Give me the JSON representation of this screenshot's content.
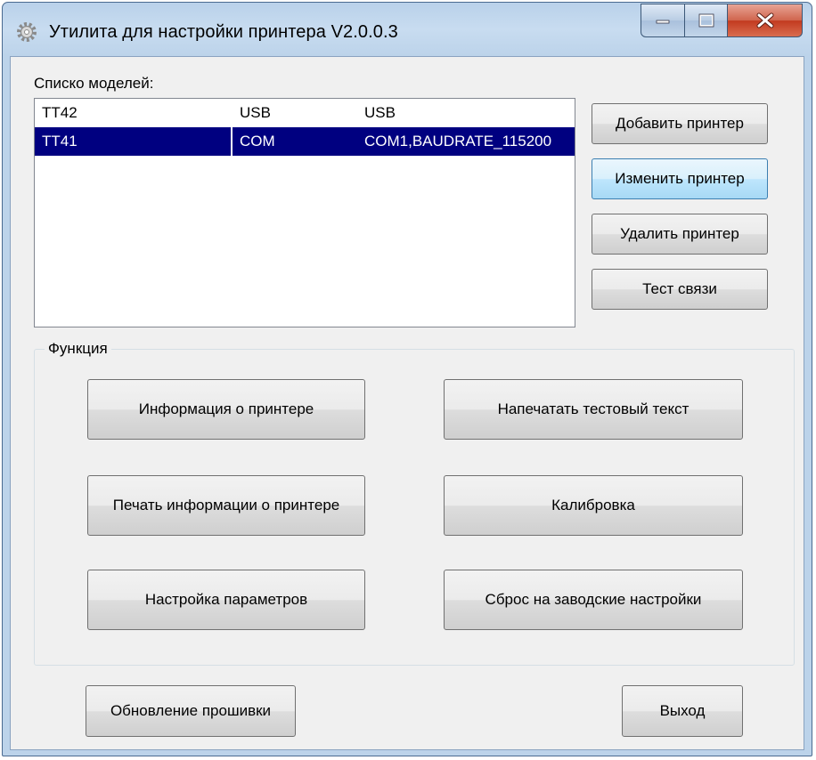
{
  "window": {
    "title": "Утилита для настройки принтера  V2.0.0.3"
  },
  "models": {
    "label": "Списко моделей:",
    "rows": [
      {
        "model": "TT42",
        "port": "USB",
        "settings": "USB",
        "selected": false
      },
      {
        "model": "TT41",
        "port": "COM",
        "settings": "COM1,BAUDRATE_115200",
        "selected": true
      }
    ]
  },
  "side_buttons": {
    "add": "Добавить принтер",
    "edit": "Изменить принтер",
    "delete": "Удалить принтер",
    "test": "Тест связи"
  },
  "function_group": {
    "label": "Функция",
    "buttons": {
      "printer_info": "Информация о принтере",
      "print_test_text": "Напечатать тестовый текст",
      "print_printer_info": "Печать информации о принтере",
      "calibration": "Калибровка",
      "param_settings": "Настройка параметров",
      "factory_reset": "Сброс на заводские настройки"
    }
  },
  "bottom": {
    "firmware": "Обновление прошивки",
    "exit": "Выход"
  },
  "colors": {
    "selection": "#000080",
    "title_close": "#c23a1f"
  }
}
